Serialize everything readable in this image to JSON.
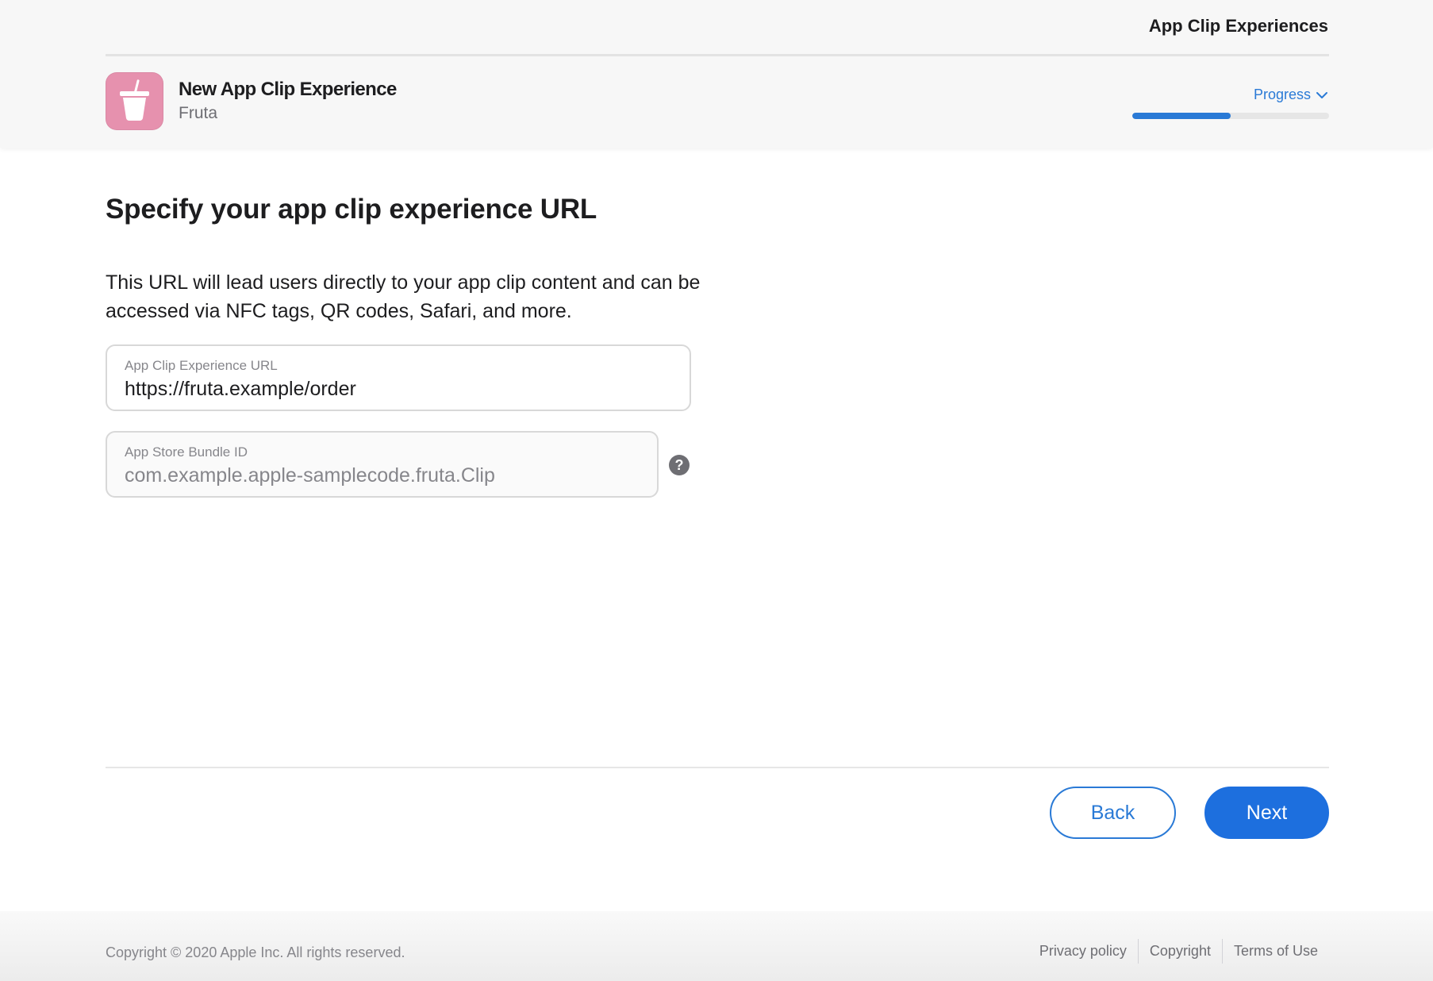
{
  "header": {
    "section_title": "App Clip Experiences",
    "app_name": "New App Clip Experience",
    "app_subtitle": "Fruta",
    "app_icon": "fruta-cup-icon",
    "progress_label": "Progress",
    "progress_fraction": 0.5
  },
  "main": {
    "heading": "Specify your app clip experience URL",
    "description": "This URL will lead users directly to your app clip content and can be accessed via NFC tags, QR codes, Safari, and more.",
    "url_field": {
      "label": "App Clip Experience URL",
      "value": "https://fruta.example/order"
    },
    "bundle_field": {
      "label": "App Store Bundle ID",
      "value": "com.example.apple-samplecode.fruta.Clip"
    },
    "help_symbol": "?"
  },
  "actions": {
    "back_label": "Back",
    "next_label": "Next"
  },
  "footer": {
    "copyright": "Copyright © 2020 Apple Inc. All rights reserved.",
    "links": [
      "Privacy policy",
      "Copyright",
      "Terms of Use"
    ]
  },
  "colors": {
    "accent": "#1d6fde",
    "icon_background": "#e691ae"
  }
}
